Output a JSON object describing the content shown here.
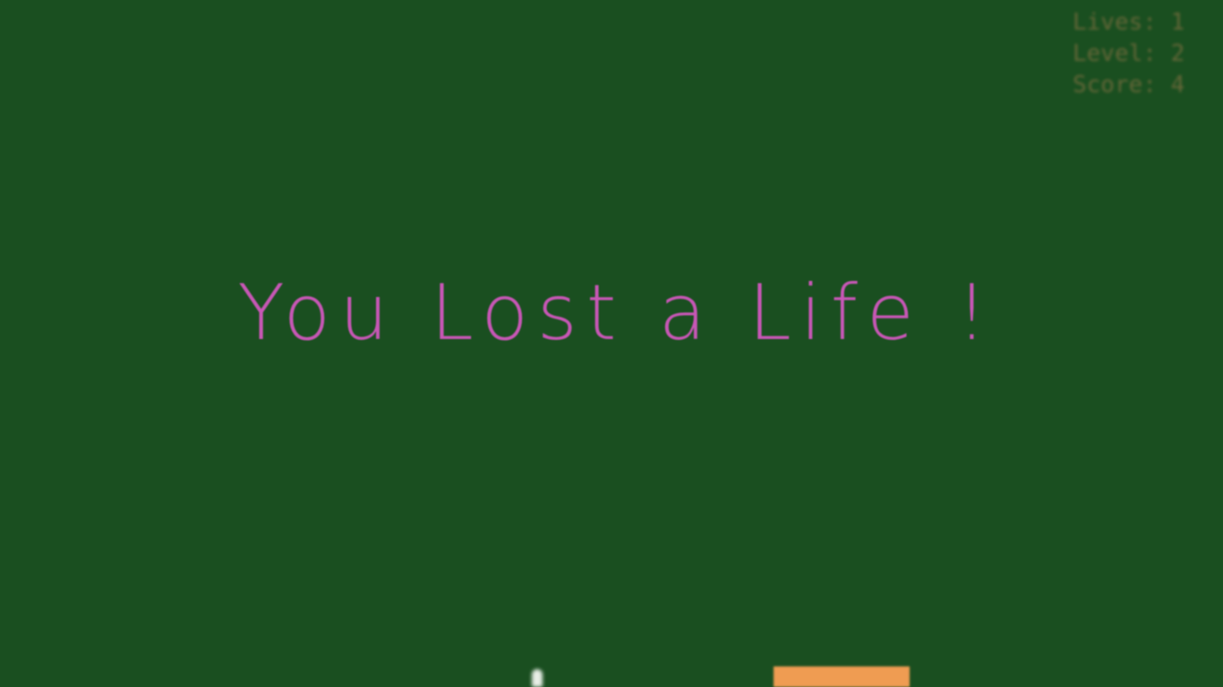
{
  "hud": {
    "lives_label": "Lives: 1",
    "level_label": "Level: 2",
    "score_label": "Score: 4"
  },
  "message": {
    "text": "You Lost a Life !"
  },
  "colors": {
    "background": "#1a4f20",
    "message": "#c857b6",
    "hud_text": "#6e6a3c",
    "paddle": "#ef9c52",
    "ball": "#e8eee6"
  }
}
